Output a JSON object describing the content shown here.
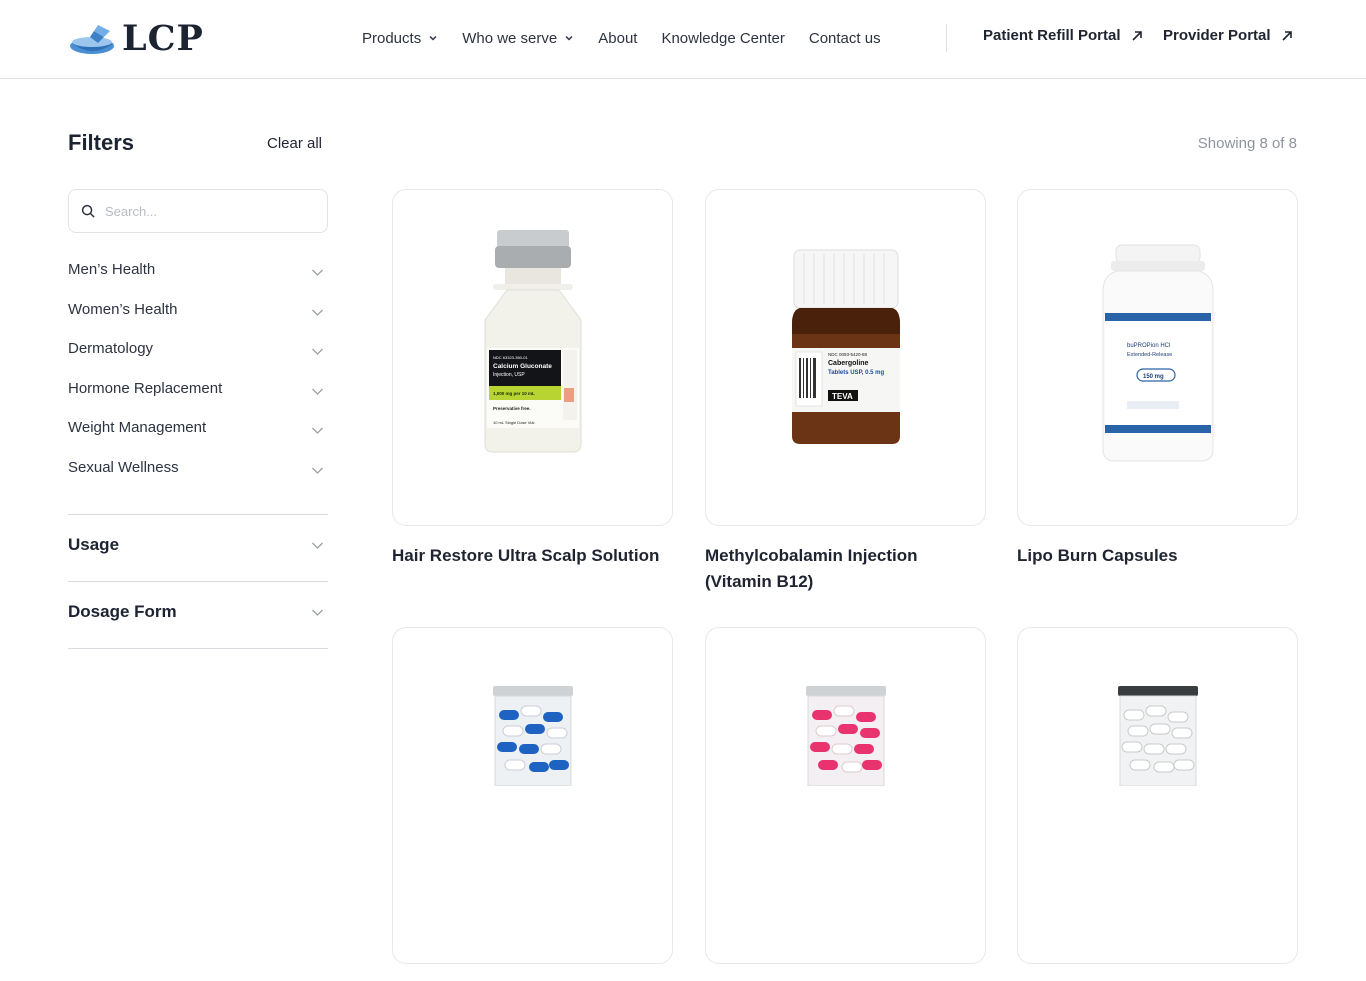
{
  "header": {
    "logo_text": "LCP",
    "nav": [
      {
        "label": "Products",
        "dropdown": true
      },
      {
        "label": "Who we serve",
        "dropdown": true
      },
      {
        "label": "About",
        "dropdown": false
      },
      {
        "label": "Knowledge Center",
        "dropdown": false
      },
      {
        "label": "Contact us",
        "dropdown": false
      }
    ],
    "portals": [
      {
        "label": "Patient Refill Portal"
      },
      {
        "label": "Provider Portal"
      }
    ]
  },
  "sidebar": {
    "title": "Filters",
    "clear_all": "Clear all",
    "search_placeholder": "Search...",
    "categories": [
      {
        "label": "Men’s Health"
      },
      {
        "label": "Women’s Health"
      },
      {
        "label": "Dermatology"
      },
      {
        "label": "Hormone Replacement"
      },
      {
        "label": "Weight Management"
      },
      {
        "label": "Sexual Wellness"
      }
    ],
    "sections": [
      {
        "label": "Usage"
      },
      {
        "label": "Dosage Form"
      }
    ]
  },
  "main": {
    "showing": "Showing 8 of 8",
    "products": [
      {
        "title": "Hair Restore Ultra Scalp Solution",
        "image": "calcium-gluconate-vial"
      },
      {
        "title": "Methylcobalamin Injection (Vitamin B12)",
        "image": "cabergoline-amber-bottle"
      },
      {
        "title": "Lipo Burn Capsules",
        "image": "bupropion-white-bottle"
      },
      {
        "title": "",
        "image": "blue-white-capsule-jar"
      },
      {
        "title": "",
        "image": "pink-white-capsule-jar"
      },
      {
        "title": "",
        "image": "white-capsule-jar"
      }
    ],
    "labels": {
      "vial_ndc": "NDC 63323-360-01",
      "vial_name": "Calcium Gluconate",
      "vial_sub": "Injection, USP",
      "vial_strength": "1,000 mg per 10 mL",
      "vial_free": "Preservative free.",
      "vial_size": "10 mL Single Dose Vial",
      "amber_ndc": "NDC 0093-5420-88",
      "amber_name": "Cabergoline",
      "amber_sub": "Tablets USP, 0.5 mg",
      "amber_brand": "TEVA",
      "white_name": "buPROPion HCl",
      "white_sub": "Extended-Release",
      "white_strength": "150 mg"
    }
  },
  "colors": {
    "accent": "#3f83c7",
    "text": "#1f2430",
    "muted": "#8e949e",
    "border": "#e6e8eb"
  }
}
